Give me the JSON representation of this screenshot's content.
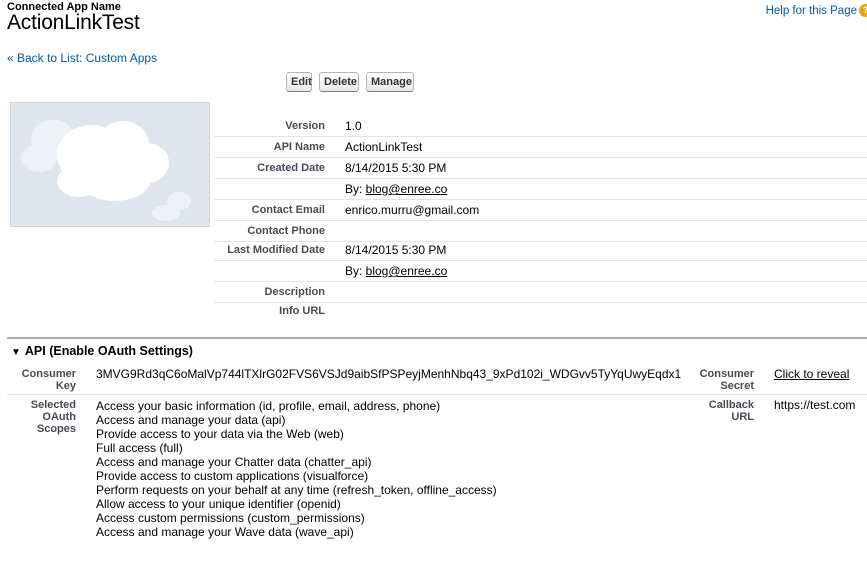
{
  "header": {
    "label": "Connected App Name",
    "title": "ActionLinkTest",
    "help_link": "Help for this Page",
    "help_icon": "?"
  },
  "nav": {
    "back_link": "« Back to List: Custom Apps"
  },
  "toolbar": {
    "edit": "Edit",
    "delete": "Delete",
    "manage": "Manage"
  },
  "details": [
    {
      "label": "Version",
      "value": "1.0"
    },
    {
      "label": "API Name",
      "value": "ActionLinkTest"
    },
    {
      "label": "Created Date",
      "value": "8/14/2015 5:30 PM"
    },
    {
      "label": "",
      "value_prefix": "By: ",
      "value_link": "blog@enree.co"
    },
    {
      "label": "Contact Email",
      "value": "enrico.murru@gmail.com"
    },
    {
      "label": "Contact Phone",
      "value": ""
    },
    {
      "label": "Last Modified Date",
      "value": "8/14/2015 5:30 PM"
    },
    {
      "label": "",
      "value_prefix": "By: ",
      "value_link": "blog@enree.co"
    },
    {
      "label": "Description",
      "value": ""
    },
    {
      "label": "Info URL",
      "value": ""
    }
  ],
  "oauth": {
    "section_title": "API (Enable OAuth Settings)",
    "consumer_key_label": "Consumer Key",
    "consumer_key": "3MVG9Rd3qC6oMalVp744lTXlrG02FVS6VSJd9aibSfPSPeyjMenhNbq43_9xPd102i_WDGvv5TyYqUwyEqdx1",
    "consumer_secret_label": "Consumer Secret",
    "consumer_secret_link": "Click to reveal",
    "scopes_label": "Selected OAuth Scopes",
    "scopes": [
      "Access your basic information (id, profile, email, address, phone)",
      "Access and manage your data (api)",
      "Provide access to your data via the Web (web)",
      "Full access (full)",
      "Access and manage your Chatter data (chatter_api)",
      "Provide access to custom applications (visualforce)",
      "Perform requests on your behalf at any time (refresh_token, offline_access)",
      "Allow access to your unique identifier (openid)",
      "Access custom permissions (custom_permissions)",
      "Access and manage your Wave data (wave_api)"
    ],
    "callback_label": "Callback URL",
    "callback_url": "https://test.com"
  },
  "colors": {
    "link": "#015ba7",
    "label": "#4a4a56",
    "section_rule": "#a6aeb5",
    "logo_bg": "#dfe5ec"
  }
}
